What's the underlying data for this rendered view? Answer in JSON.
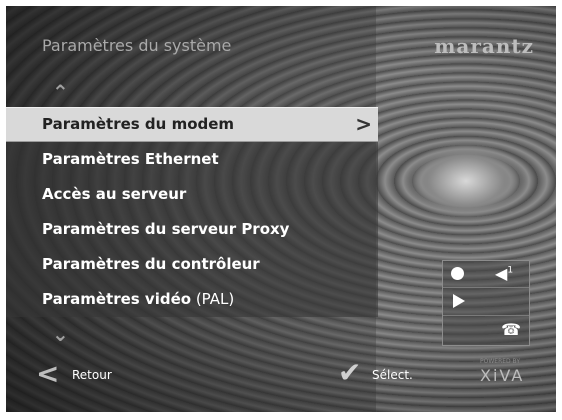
{
  "header": {
    "title": "Paramètres du système",
    "brand_logo": "marantz"
  },
  "menu": {
    "scroll_up_icon": "chevron-up-icon",
    "scroll_down_icon": "chevron-down-icon",
    "items": [
      {
        "label": "Paramètres du modem",
        "selected": true
      },
      {
        "label": "Paramètres Ethernet"
      },
      {
        "label": "Accès au serveur"
      },
      {
        "label": "Paramètres du serveur Proxy"
      },
      {
        "label": "Paramètres du contrôleur"
      },
      {
        "label_main": "Paramètres vidéo",
        "label_suffix": " (PAL)"
      }
    ],
    "selected_arrow": ">"
  },
  "status_panel": {
    "icons": [
      "record-icon",
      "volume-icon",
      "play-icon",
      "phone-icon"
    ],
    "volume_level": "1"
  },
  "footer": {
    "back_label": "Retour",
    "select_label": "Sélect.",
    "xiva_small": "POWERED BY",
    "xiva_logo": "XiVA"
  }
}
